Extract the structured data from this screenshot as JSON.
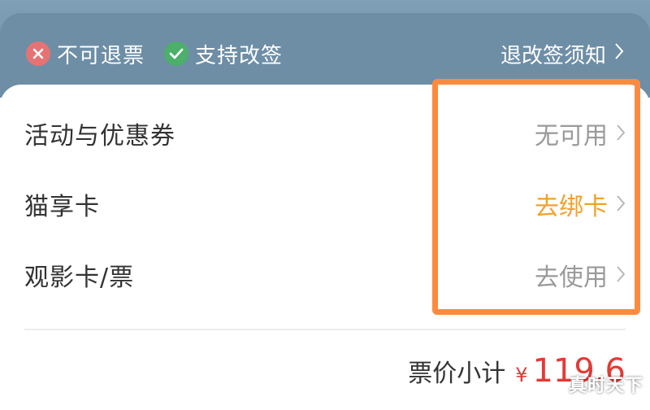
{
  "header": {
    "not_refundable": "不可退票",
    "supports_change": "支持改签",
    "policy_link": "退改签须知"
  },
  "rows": [
    {
      "label": "活动与优惠券",
      "action": "无可用"
    },
    {
      "label": "猫享卡",
      "action": "去绑卡"
    },
    {
      "label": "观影卡/票",
      "action": "去使用"
    }
  ],
  "summary": {
    "label": "票价小计",
    "currency": "¥",
    "price": "119.6"
  },
  "watermark": "真时天下",
  "colors": {
    "orange_highlight": "#ff8a3d",
    "action_orange": "#f2a12b",
    "price_red": "#e53935",
    "header_bg": "#6e8ea6"
  },
  "icons": {
    "not_refundable": "x-circle-icon",
    "supports_change": "check-circle-icon",
    "chevron": "chevron-right-icon"
  }
}
